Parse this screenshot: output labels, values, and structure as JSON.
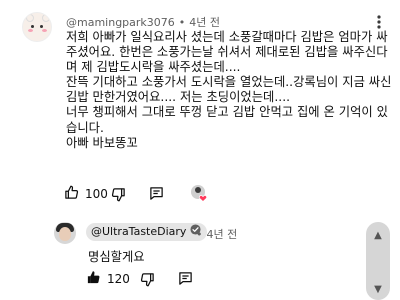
{
  "comment": {
    "handle": "@mamingpark3076",
    "separator": "•",
    "time": "4년 전",
    "lines": [
      "저희 아빠가 일식요리사 셨는데 소풍갈때마다 김밥은 엄마가 싸",
      "주셨어요. 한번은 소풍가는날 쉬셔서 제대로된 김밥을 싸주신다",
      "며 제 김밥도시락을 싸주셨는데....",
      "잔뜩 기대하고 소풍가서 도시락을 열었는데..강록님이 지금 싸신",
      "김밥 만한거였어요.... 저는 초딩이었는데....",
      "너무 챙피해서 그대로 뚜껑 닫고 김밥 안먹고 집에 온 기억이 있",
      "습니다.",
      "아빠 바보똥꼬"
    ],
    "likes": "100"
  },
  "reply": {
    "handle": "@UltraTasteDiary",
    "separator": "•",
    "time": "4년 전",
    "text": "명심할게요",
    "likes": "120"
  },
  "icons": {
    "verified": "check-circle-icon",
    "like": "thumbs-up-icon",
    "dislike": "thumbs-down-icon",
    "reply": "comment-icon",
    "more": "more-vert-icon",
    "creator_heart": "creator-heart-icon"
  },
  "colors": {
    "heart": "#ff3b5c",
    "text": "#0f0f0f",
    "meta": "#606060",
    "badge_bg": "#e5e5e5"
  }
}
